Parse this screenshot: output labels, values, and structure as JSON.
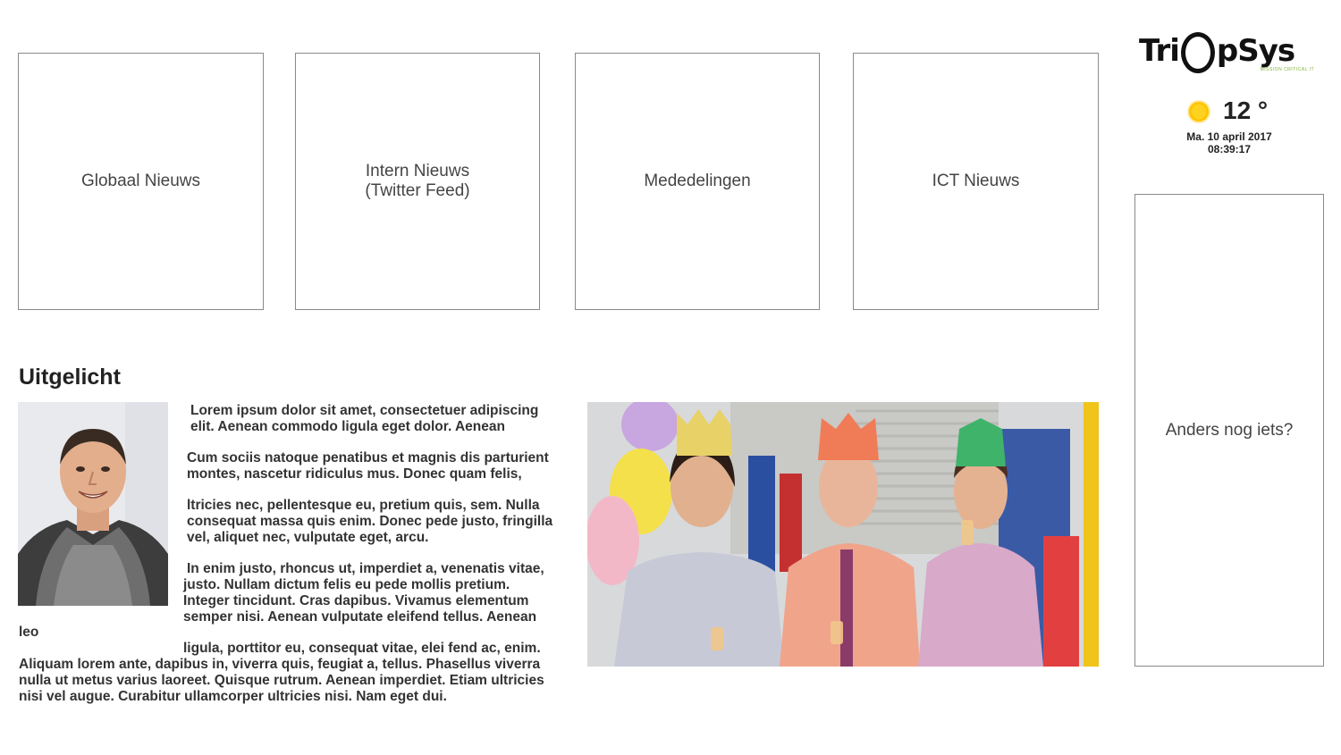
{
  "tiles": {
    "global_news": "Globaal Nieuws",
    "internal_news_line1": "Intern Nieuws",
    "internal_news_line2": "(Twitter Feed)",
    "announcements": "Mededelingen",
    "ict_news": "ICT Nieuws",
    "other": "Anders nog iets?"
  },
  "logo": {
    "text_left": "Tri",
    "text_right": "pSys",
    "tagline": "MISSION CRITICAL IT",
    "tagline_color": "#7bb32e"
  },
  "weather": {
    "icon": "sun-icon",
    "temperature": "12 °",
    "date": "Ma. 10 april 2017",
    "time": "08:39:17"
  },
  "featured": {
    "title": "Uitgelicht",
    "lines": [
      "Lorem ipsum dolor sit amet, consectetuer adipiscing",
      "elit. Aenean commodo ligula eget dolor. Aenean",
      "Cum sociis natoque penatibus et magnis dis parturient",
      "montes, nascetur ridiculus mus. Donec quam felis,",
      "ltricies nec, pellentesque eu, pretium quis, sem. Nulla",
      "consequat massa quis enim. Donec pede justo, fringilla",
      "vel, aliquet nec, vulputate eget, arcu.",
      "In enim justo, rhoncus ut, imperdiet a, venenatis vitae,",
      "justo. Nullam dictum felis eu pede mollis pretium.",
      "Integer tincidunt. Cras dapibus. Vivamus elementum",
      "semper nisi. Aenean vulputate eleifend tellus. Aenean",
      "leo",
      "ligula, porttitor eu, consequat vitae, elei fend ac, enim.",
      "Aliquam lorem ante, dapibus in, viverra quis, feugiat a, tellus. Phasellus viverra",
      "nulla ut metus varius laoreet. Quisque rutrum. Aenean imperdiet. Etiam ultricies",
      "nisi vel augue. Curabitur ullamcorper ultricies nisi. Nam eget dui."
    ]
  },
  "colors": {
    "tile_border": "#8a8a8a",
    "text": "#333333",
    "sun": "#ffc400"
  }
}
